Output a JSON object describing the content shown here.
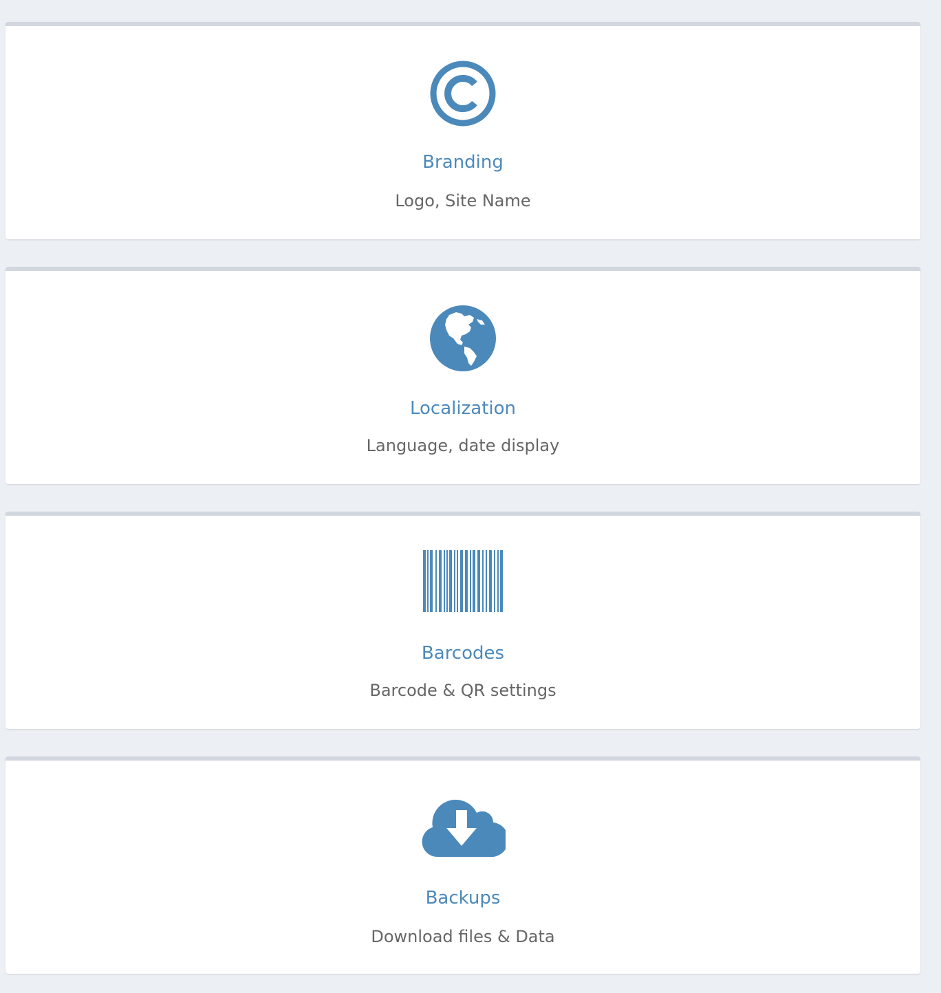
{
  "settings": {
    "accent_color": "#4c89bb",
    "cards": [
      {
        "icon": "copyright-icon",
        "title": "Branding",
        "subtitle": "Logo, Site Name"
      },
      {
        "icon": "globe-icon",
        "title": "Localization",
        "subtitle": "Language, date display"
      },
      {
        "icon": "barcode-icon",
        "title": "Barcodes",
        "subtitle": "Barcode & QR settings"
      },
      {
        "icon": "cloud-download-icon",
        "title": "Backups",
        "subtitle": "Download files & Data"
      }
    ]
  }
}
